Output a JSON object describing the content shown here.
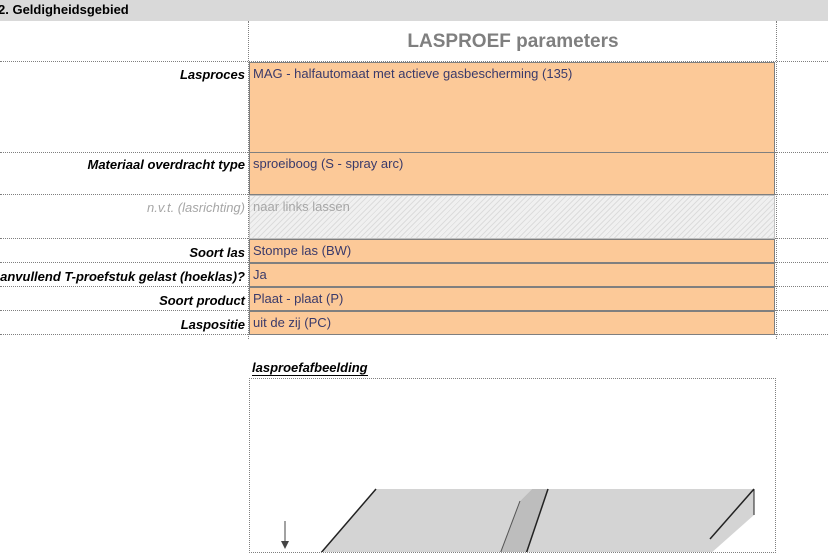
{
  "section": {
    "title": "2. Geldigheidsgebied"
  },
  "params_title": "LASPROEF parameters",
  "rows": [
    {
      "label": "Lasproces",
      "value": "MAG - halfautomaat met actieve gasbescherming (135)"
    },
    {
      "label": "Materiaal overdracht type",
      "value": "sproeiboog (S - spray arc)"
    },
    {
      "label": "n.v.t. (lasrichting)",
      "value": "naar links lassen"
    },
    {
      "label": "Soort las",
      "value": "Stompe las (BW)"
    },
    {
      "label": "Aanvullend T-proefstuk gelast (hoeklas)?",
      "value": "Ja"
    },
    {
      "label": "Soort product",
      "value": "Plaat - plaat (P)"
    },
    {
      "label": "Laspositie",
      "value": "uit de zij (PC)"
    }
  ],
  "image_section": {
    "label": "lasproefafbeelding"
  },
  "colors": {
    "input_fill": "#fcc998",
    "header_fill": "#d9d9d9",
    "title_gray": "#7f7f7f"
  }
}
